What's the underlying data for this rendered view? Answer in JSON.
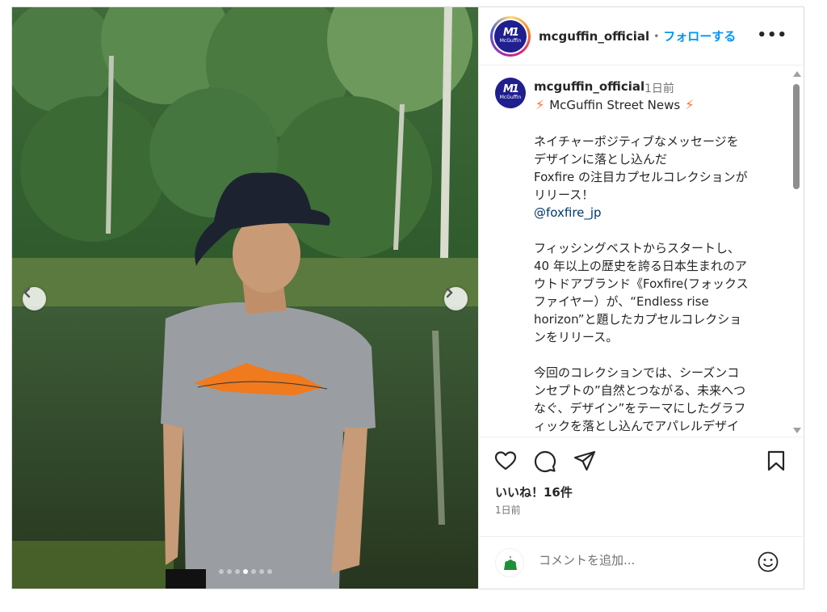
{
  "header": {
    "logo_mark": "M1",
    "logo_brand": "McGuffin",
    "username": "mcguffin_official",
    "separator": "•",
    "follow_label": "フォローする",
    "more_label": "•••"
  },
  "caption": {
    "username": "mcguffin_official",
    "time": "1日前",
    "title": "McGuffin Street News",
    "paragraph1": "ネイチャーポジティブなメッセージを\nデザインに落とし込んだ\nFoxfire の注目カプセルコレクションが\nリリース！",
    "mention": "@foxfire_jp",
    "paragraph2": "フィッシングベストからスタートし、\n40 年以上の歴史を誇る日本生まれのア\nウトドアブランド《Foxfire(フォックス\nファイヤー）が、“Endless rise\nhorizon”と題したカプセルコレクショ\nンをリリース。",
    "paragraph3": "今回のコレクションでは、シーズンコ\nンセプトの”自然とつながる、未来へつ\nなぐ、デザイン”をテーマにしたグラフ\nィックを落とし込んでアパレルデザイ\nンを制作。"
  },
  "carousel": {
    "slide_count": 7,
    "active_index": 3
  },
  "stats": {
    "likes": "いいね！16件",
    "posted": "1日前"
  },
  "comment": {
    "placeholder": "コメントを追加..."
  },
  "colors": {
    "accent": "#0095f6",
    "brand": "#1f1f8f",
    "bolt": "#ff6a2a"
  }
}
